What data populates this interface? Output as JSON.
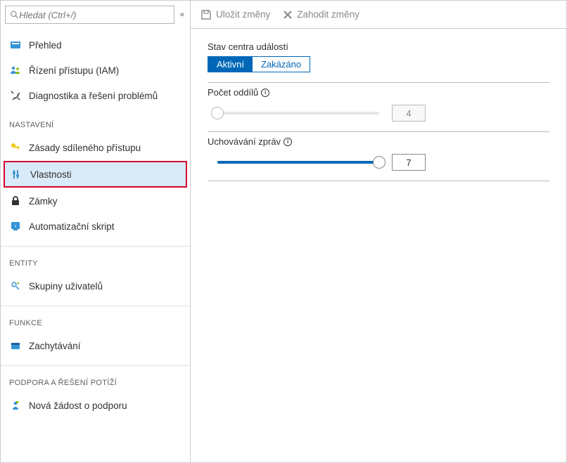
{
  "search": {
    "placeholder": "Hledat (Ctrl+/)"
  },
  "sidebar": {
    "topItems": [
      {
        "label": "Přehled",
        "icon": "overview-icon"
      },
      {
        "label": "Řízení přístupu (IAM)",
        "icon": "iam-icon"
      },
      {
        "label": "Diagnostika a řešení problémů",
        "icon": "diagnostics-icon"
      }
    ],
    "sections": [
      {
        "header": "NASTAVENÍ",
        "items": [
          {
            "label": "Zásady sdíleného přístupu",
            "icon": "key-icon"
          },
          {
            "label": "Vlastnosti",
            "icon": "properties-icon",
            "selected": true
          },
          {
            "label": "Zámky",
            "icon": "lock-icon"
          },
          {
            "label": "Automatizační skript",
            "icon": "script-icon"
          }
        ]
      },
      {
        "header": "ENTITY",
        "items": [
          {
            "label": "Skupiny uživatelů",
            "icon": "groups-icon"
          }
        ]
      },
      {
        "header": "FUNKCE",
        "items": [
          {
            "label": "Zachytávání",
            "icon": "capture-icon"
          }
        ]
      },
      {
        "header": "PODPORA A ŘEŠENÍ POTÍŽÍ",
        "items": [
          {
            "label": "Nová žádost o podporu",
            "icon": "support-icon"
          }
        ]
      }
    ]
  },
  "toolbar": {
    "save_label": "Uložit změny",
    "discard_label": "Zahodit změny"
  },
  "form": {
    "status": {
      "label": "Stav centra událostí",
      "active": "Aktivní",
      "disabled": "Zakázáno",
      "selected": "active"
    },
    "partitions": {
      "label": "Počet oddílů",
      "value": "4",
      "min": 1,
      "max": 32,
      "fill_pct": 0,
      "enabled": false
    },
    "retention": {
      "label": "Uchovávání zpráv",
      "value": "7",
      "min": 1,
      "max": 7,
      "fill_pct": 100,
      "enabled": true
    }
  }
}
